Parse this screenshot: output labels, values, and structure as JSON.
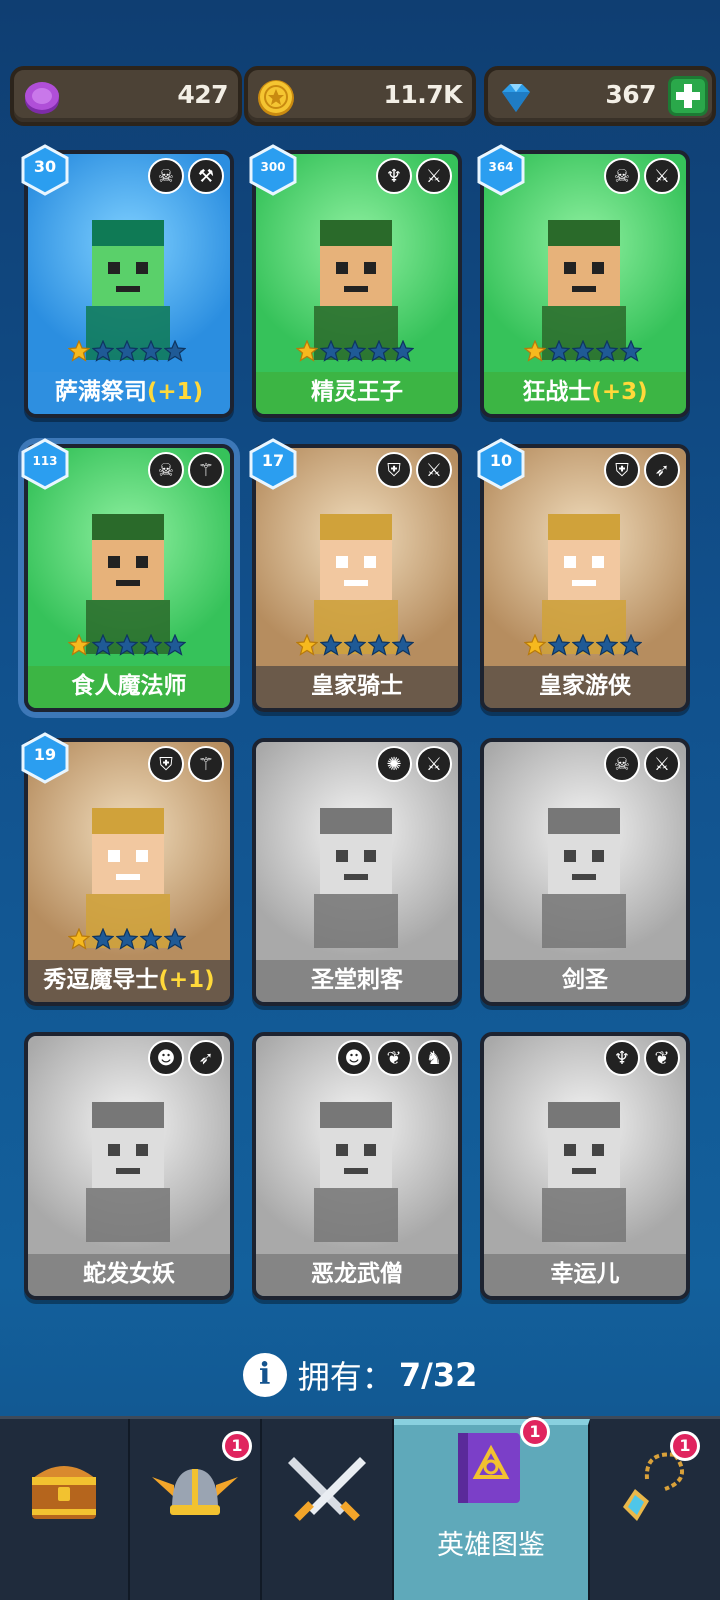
{
  "currencies": {
    "gems": "427",
    "coins": "11.7K",
    "diamonds": "367"
  },
  "heroes": [
    {
      "name": "萨满祭司",
      "bonus": "(+1)",
      "level": "30",
      "bg": "blue",
      "tags": [
        "orc-faction-icon",
        "hammer-icon"
      ],
      "stars": 1,
      "locked": false
    },
    {
      "name": "精灵王子",
      "bonus": "",
      "level": "300",
      "bg": "green",
      "tags": [
        "elf-faction-icon",
        "sword-icon"
      ],
      "stars": 1,
      "locked": false
    },
    {
      "name": "狂战士",
      "bonus": "(+3)",
      "level": "364",
      "bg": "green",
      "tags": [
        "orc-faction-icon",
        "sword-icon"
      ],
      "stars": 1,
      "locked": false
    },
    {
      "name": "食人魔法师",
      "bonus": "",
      "level": "113",
      "bg": "green",
      "tags": [
        "orc-faction-icon",
        "wand-icon"
      ],
      "stars": 1,
      "locked": false,
      "selected": true
    },
    {
      "name": "皇家骑士",
      "bonus": "",
      "level": "17",
      "bg": "brown",
      "tags": [
        "helmet-faction-icon",
        "sword-icon"
      ],
      "stars": 1,
      "locked": false
    },
    {
      "name": "皇家游侠",
      "bonus": "",
      "level": "10",
      "bg": "brown",
      "tags": [
        "helmet-faction-icon",
        "bow-icon"
      ],
      "stars": 1,
      "locked": false
    },
    {
      "name": "秀逗魔导士",
      "bonus": "(+1)",
      "level": "19",
      "bg": "brown",
      "tags": [
        "helmet-faction-icon",
        "wand-icon"
      ],
      "stars": 1,
      "locked": false
    },
    {
      "name": "圣堂刺客",
      "bonus": "",
      "level": "",
      "bg": "gray",
      "tags": [
        "angel-faction-icon",
        "sword-icon"
      ],
      "stars": 0,
      "locked": true
    },
    {
      "name": "剑圣",
      "bonus": "",
      "level": "",
      "bg": "gray",
      "tags": [
        "orc-faction-icon",
        "sword-icon"
      ],
      "stars": 0,
      "locked": true
    },
    {
      "name": "蛇发女妖",
      "bonus": "",
      "level": "",
      "bg": "gray",
      "tags": [
        "demon-faction-icon",
        "bow-icon"
      ],
      "stars": 0,
      "locked": true
    },
    {
      "name": "恶龙武僧",
      "bonus": "",
      "level": "",
      "bg": "gray",
      "tags": [
        "demon-faction-icon",
        "beast-icon",
        "dragon-icon"
      ],
      "stars": 0,
      "locked": true
    },
    {
      "name": "幸运儿",
      "bonus": "",
      "level": "",
      "bg": "gray",
      "tags": [
        "elf-faction-icon",
        "beast-icon"
      ],
      "stars": 0,
      "locked": true
    }
  ],
  "owned": {
    "label": "拥有：",
    "count": "7/32"
  },
  "nav": [
    {
      "name": "chest",
      "label": "",
      "badge": ""
    },
    {
      "name": "heroes",
      "label": "",
      "badge": "1"
    },
    {
      "name": "battle",
      "label": "",
      "badge": ""
    },
    {
      "name": "codex",
      "label": "英雄图鉴",
      "badge": "1",
      "active": true
    },
    {
      "name": "amulet",
      "label": "",
      "badge": "1"
    }
  ],
  "colors": {
    "background": "#11508c",
    "nav_active": "#5fa9ba",
    "badge": "#e0245e",
    "bonus_text": "#ffd93a"
  }
}
